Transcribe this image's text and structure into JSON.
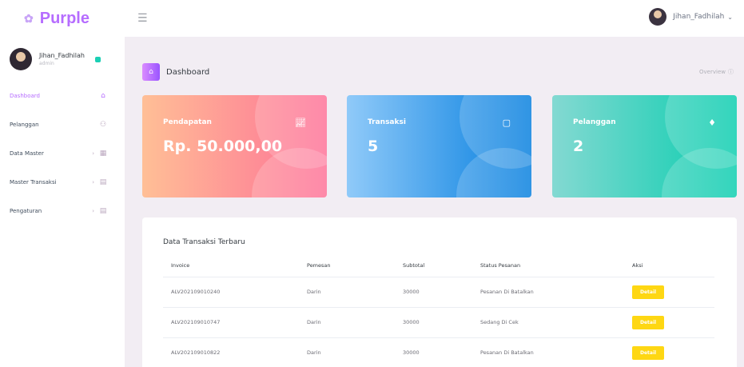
{
  "brand": {
    "name": "Purple",
    "icon": "flower-icon"
  },
  "topbar": {
    "user_name": "Jihan_Fadhilah"
  },
  "sidebar": {
    "profile": {
      "name": "Jihan_Fadhilah",
      "role": "admin"
    },
    "items": [
      {
        "label": "Dashboard",
        "icon": "home-icon",
        "active": true
      },
      {
        "label": "Pelanggan",
        "icon": "people-icon"
      },
      {
        "label": "Data Master",
        "icon": "grid-icon"
      },
      {
        "label": "Master Transaksi",
        "icon": "table-icon"
      },
      {
        "label": "Pengaturan",
        "icon": "table-icon"
      }
    ]
  },
  "page": {
    "title": "Dashboard",
    "overview": "Overview"
  },
  "cards": [
    {
      "label": "Pendapatan",
      "value": "Rp. 50.000,00",
      "icon": "chart-icon"
    },
    {
      "label": "Transaksi",
      "value": "5",
      "icon": "bookmark-icon"
    },
    {
      "label": "Pelanggan",
      "value": "2",
      "icon": "diamond-icon"
    }
  ],
  "table": {
    "title": "Data Transaksi Terbaru",
    "headers": [
      "Invoice",
      "Pemesan",
      "Subtotal",
      "Status Pesanan",
      "Aksi"
    ],
    "rows": [
      {
        "invoice": "ALV202109010240",
        "pemesan": "Darin",
        "subtotal": "30000",
        "status": "Pesanan Di Batalkan",
        "action": "Detail"
      },
      {
        "invoice": "ALV202109010747",
        "pemesan": "Darin",
        "subtotal": "30000",
        "status": "Sedang Di Cek",
        "action": "Detail"
      },
      {
        "invoice": "ALV202109010822",
        "pemesan": "Darin",
        "subtotal": "30000",
        "status": "Pesanan Di Batalkan",
        "action": "Detail"
      }
    ]
  },
  "colors": {
    "accent": "#b66dff",
    "danger_from": "#ffbf96",
    "danger_to": "#fe7096",
    "info_from": "#90caf9",
    "info_to": "#047edf",
    "success_from": "#84d9d2",
    "success_to": "#07cdae",
    "warning": "#fed713"
  }
}
